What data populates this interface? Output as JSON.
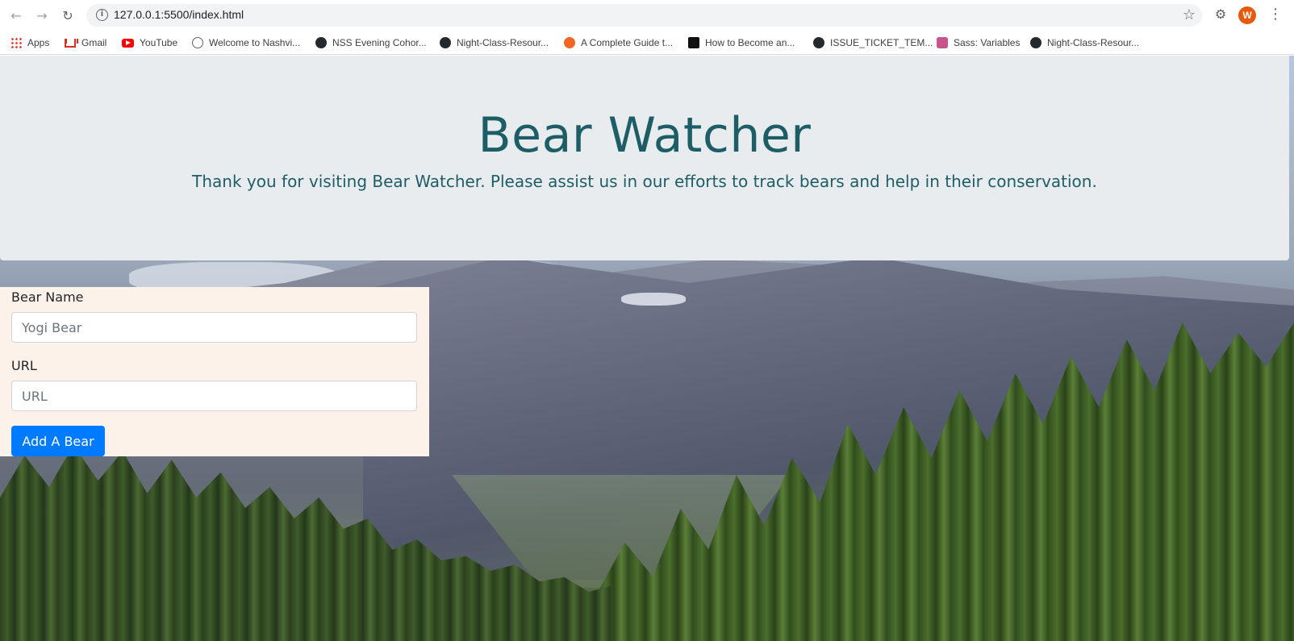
{
  "browser": {
    "url": "127.0.0.1:5500/index.html",
    "profile_initial": "W",
    "bookmarks": [
      {
        "label": "Apps",
        "icon": "apps-grid-icon"
      },
      {
        "label": "Gmail",
        "icon": "gmail-icon"
      },
      {
        "label": "YouTube",
        "icon": "youtube-icon"
      },
      {
        "label": "Welcome to Nashvi...",
        "icon": "globe-icon"
      },
      {
        "label": "NSS Evening Cohor...",
        "icon": "github-icon"
      },
      {
        "label": "Night-Class-Resour...",
        "icon": "github-icon"
      },
      {
        "label": "A Complete Guide t...",
        "icon": "site-icon"
      },
      {
        "label": "How to Become an...",
        "icon": "site-icon"
      },
      {
        "label": "ISSUE_TICKET_TEM...",
        "icon": "github-icon"
      },
      {
        "label": "Sass: Variables",
        "icon": "sass-icon"
      },
      {
        "label": "Night-Class-Resour...",
        "icon": "github-icon"
      }
    ]
  },
  "header": {
    "title": "Bear Watcher",
    "subtitle": "Thank you for visiting Bear Watcher. Please assist us in our efforts to track bears and help in their conservation."
  },
  "form": {
    "name_label": "Bear Name",
    "name_placeholder": "Yogi Bear",
    "url_label": "URL",
    "url_placeholder": "URL",
    "submit_label": "Add A Bear"
  },
  "colors": {
    "title": "#1d5e66",
    "jumbotron_bg": "#e9ecef",
    "form_bg": "#fdf2e9",
    "button": "#007bff"
  }
}
